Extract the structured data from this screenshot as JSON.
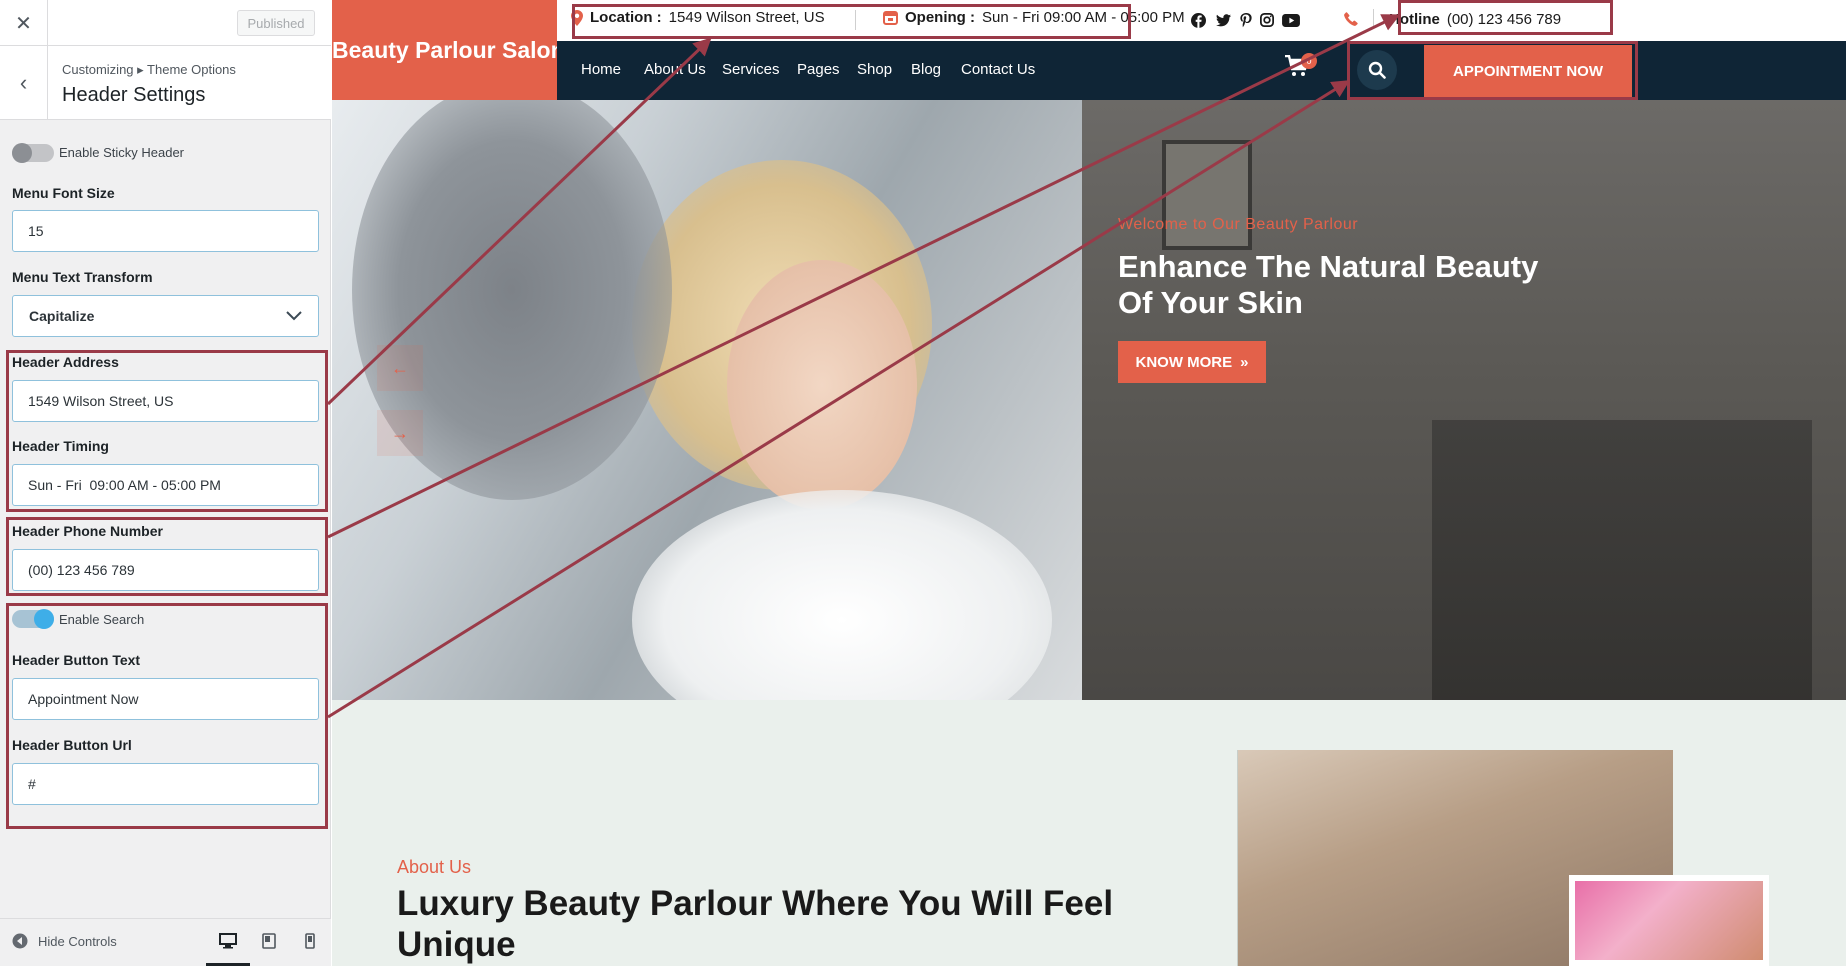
{
  "customizer": {
    "published_label": "Published",
    "breadcrumb": "Customizing ▸ Theme Options",
    "section_title": "Header Settings",
    "sticky_toggle_label": "Enable Sticky Header",
    "menu_font_size_label": "Menu Font Size",
    "menu_font_size_value": "15",
    "menu_text_transform_label": "Menu Text Transform",
    "menu_text_transform_value": "Capitalize",
    "header_address_label": "Header Address",
    "header_address_value": "1549 Wilson Street, US",
    "header_timing_label": "Header Timing",
    "header_timing_value": "Sun - Fri  09:00 AM - 05:00 PM",
    "header_phone_label": "Header Phone Number",
    "header_phone_value": "(00) 123 456 789",
    "search_toggle_label": "Enable Search",
    "header_button_text_label": "Header Button Text",
    "header_button_text_value": "Appointment Now",
    "header_button_url_label": "Header Button Url",
    "header_button_url_value": "#",
    "hide_controls_label": "Hide Controls",
    "toggles": {
      "sticky_header": false,
      "search": true
    }
  },
  "site": {
    "logo_text": "Beauty Parlour Salon",
    "topbar": {
      "location_label": "Location :",
      "location_value": "1549 Wilson Street, US",
      "opening_label": "Opening :",
      "opening_value": "Sun - Fri 09:00 AM - 05:00 PM",
      "hotline_label": "Hotline",
      "hotline_value": "(00) 123 456 789",
      "social_icons": [
        "facebook-icon",
        "twitter-icon",
        "pinterest-icon",
        "instagram-icon",
        "youtube-icon"
      ]
    },
    "nav": [
      "Home",
      "About Us",
      "Services",
      "Pages",
      "Shop",
      "Blog",
      "Contact Us"
    ],
    "cart_count": "0",
    "appointment_button": "Appointment Now",
    "hero": {
      "kicker": "Welcome to Our Beauty Parlour",
      "title": "Enhance The Natural Beauty Of Your Skin",
      "button": "Know More"
    },
    "about": {
      "kicker": "About Us",
      "title": "Luxury Beauty Parlour Where You Will Feel Unique"
    }
  },
  "colors": {
    "brand": "#e3614a",
    "navbar": "#0f2536",
    "highlight": "#9a3a48",
    "toggle_on": "#3eaee8"
  }
}
